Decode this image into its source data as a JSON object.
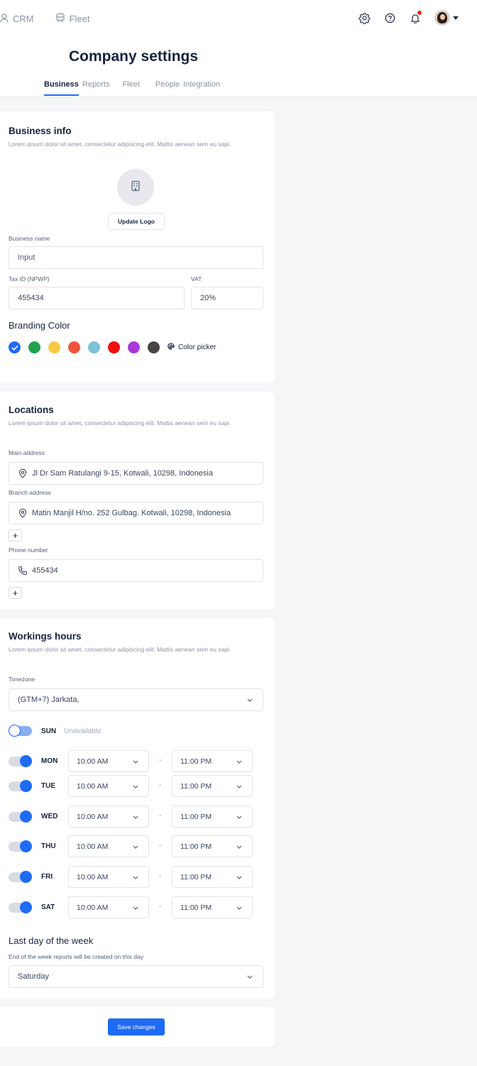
{
  "nav": {
    "crm": "CRM",
    "fleet": "Fleet"
  },
  "page": {
    "title": "Company settings",
    "tabs": [
      "Business",
      "Reports",
      "Fleet",
      "People",
      "Integration"
    ]
  },
  "business": {
    "title": "Business info",
    "desc": "Lorem ipsum dolor sit amet, consectetur adipiscing elit. Mattis aenean sem eu sapi.",
    "update_logo": "Update Logo",
    "name_label": "Business name",
    "name_placeholder": "Input",
    "tax_label": "Tax ID (NPWP)",
    "tax_value": "455434",
    "vat_label": "VAT",
    "vat_value": "20%",
    "branding_title": "Branding Color",
    "colors": [
      "#1e6bf5",
      "#1fa34f",
      "#f7c846",
      "#f0533d",
      "#7cc3d6",
      "#ef0f0f",
      "#a93ad6",
      "#4a4543"
    ],
    "selected_color": "#1e6bf5",
    "picker_label": "Color picker"
  },
  "locations": {
    "title": "Locations",
    "desc": "Lorem ipsum dolor sit amet, consectetur adipiscing elit. Mattis aenean sem eu sapi.",
    "main_label": "Main address",
    "main_value": "Jl Dr Sam Ratulangi 9-15, Kotwali, 10298, Indonesia",
    "branch_label": "Branch address",
    "branch_value": "Matin Manjil H/no. 252 Gulbag. Kotwali, 10298, Indonesia",
    "phone_label": "Phone number",
    "phone_value": "455434",
    "plus": "+"
  },
  "hours": {
    "title": "Workings hours",
    "desc": "Lorem ipsum dolor sit amet, consectetur adipiscing elit. Mattis aenean sem eu sapi.",
    "timezone_label": "Timezone",
    "timezone_value": "(GTM+7) Jarkata,",
    "unavailable": "Unavailable",
    "days": [
      {
        "day": "SUN",
        "on": false
      },
      {
        "day": "MON",
        "on": true,
        "from": "10:00 AM",
        "to": "11:00 PM"
      },
      {
        "day": "TUE",
        "on": true,
        "from": "10:00 AM",
        "to": "11:00 PM"
      },
      {
        "day": "WED",
        "on": true,
        "from": "10:00 AM",
        "to": "11:00 PM"
      },
      {
        "day": "THU",
        "on": true,
        "from": "10:00 AM",
        "to": "11:00 PM"
      },
      {
        "day": "FRI",
        "on": true,
        "from": "10:00 AM",
        "to": "11:00 PM"
      },
      {
        "day": "SAT",
        "on": true,
        "from": "10:00 AM",
        "to": "11:00 PM"
      }
    ],
    "dash": "-",
    "last_day_title": "Last day of the week",
    "last_day_desc": "End of the week reports will be created on this day",
    "last_day_value": "Saturday"
  },
  "footer": {
    "save": "Save changes"
  },
  "icons": {
    "chevron": "⌄"
  }
}
